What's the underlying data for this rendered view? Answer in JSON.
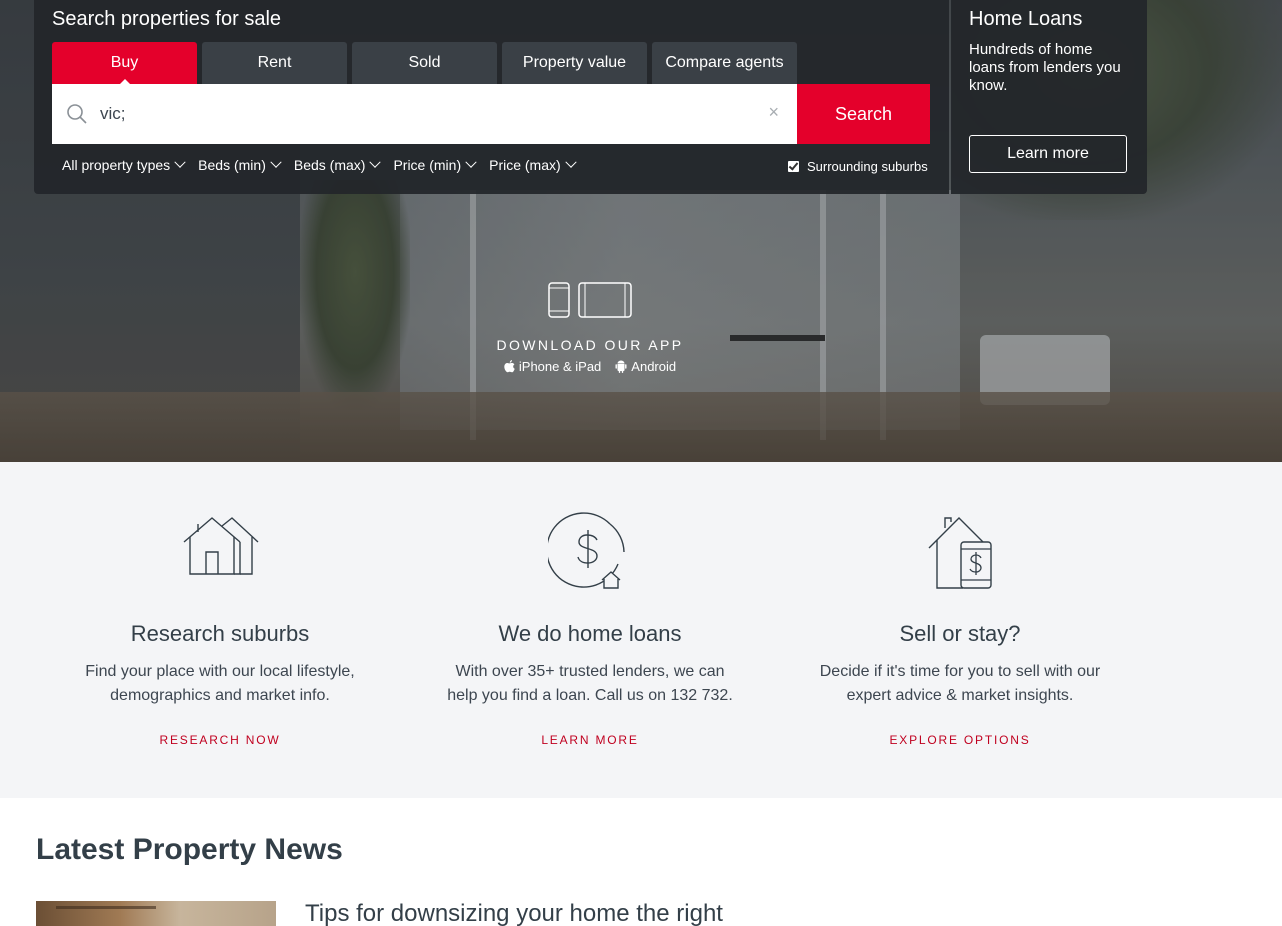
{
  "search": {
    "title": "Search properties for sale",
    "tabs": [
      {
        "label": "Buy",
        "active": true
      },
      {
        "label": "Rent",
        "active": false
      },
      {
        "label": "Sold",
        "active": false
      },
      {
        "label": "Property value",
        "active": false
      },
      {
        "label": "Compare agents",
        "active": false
      }
    ],
    "query": "vic;",
    "clear_icon": "×",
    "button": "Search",
    "filters": [
      "All property types",
      "Beds (min)",
      "Beds (max)",
      "Price (min)",
      "Price (max)"
    ],
    "surrounding_label": "Surrounding suburbs",
    "surrounding_checked": true
  },
  "home_loans": {
    "title": "Home Loans",
    "description": "Hundreds of home loans from lenders you know.",
    "button": "Learn more"
  },
  "app": {
    "title": "DOWNLOAD OUR APP",
    "iphone": "iPhone & iPad",
    "android": "Android"
  },
  "features": [
    {
      "icon": "house-icon",
      "title": "Research suburbs",
      "line1": "Find your place with our local lifestyle,",
      "line2": "demographics and market info.",
      "link": "RESEARCH NOW"
    },
    {
      "icon": "dollar-house-icon",
      "title": "We do home loans",
      "line1": "With over 35+ trusted lenders, we can",
      "line2": "help you find a loan. Call us on 132 732.",
      "link": "LEARN MORE"
    },
    {
      "icon": "house-phone-dollar-icon",
      "title": "Sell or stay?",
      "line1": "Decide if it's time for you to sell with our",
      "line2": "expert advice & market insights.",
      "link": "EXPLORE OPTIONS"
    }
  ],
  "news": {
    "title": "Latest Property News",
    "headline": "Tips for downsizing your home the right"
  },
  "colors": {
    "brand_red": "#e4002b",
    "panel_dark": "#22262a",
    "features_bg": "#f4f5f7",
    "link_red": "#c0001f"
  }
}
